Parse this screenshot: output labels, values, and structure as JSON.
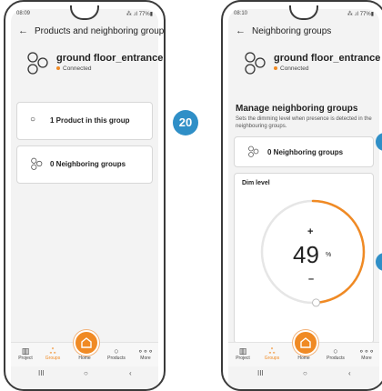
{
  "colors": {
    "accent": "#f08a24",
    "badge": "#2f8fc7"
  },
  "screen1": {
    "status_time": "08:09",
    "status_right": "⁂ .ıl 77%▮",
    "header_title": "Products and neighboring groups",
    "group_name": "ground floor_entrance",
    "status_text": "Connected",
    "rows": [
      {
        "label": "1 Product in this group",
        "icon": "circle-icon"
      },
      {
        "label": "0 Neighboring groups",
        "icon": "neighbor-groups-icon"
      }
    ]
  },
  "screen2": {
    "status_time": "08:10",
    "status_right": "⁂ .ıl 77%▮",
    "header_title": "Neighboring groups",
    "group_name": "ground floor_entrance",
    "status_text": "Connected",
    "section_title": "Manage neighboring groups",
    "section_desc": "Sets the dimming level when presence is detected in the neighbouring groups.",
    "row_label": "0 Neighboring groups",
    "dim_title": "Dim level",
    "dim_plus": "+",
    "dim_value": "49",
    "dim_unit": "%",
    "dim_minus": "–",
    "dim_fraction": 0.49
  },
  "badge": {
    "number": "20"
  },
  "nav": [
    {
      "label": "Project",
      "icon": "project-icon",
      "glyph": "▥"
    },
    {
      "label": "Groups",
      "icon": "groups-icon",
      "glyph": "ஃ"
    },
    {
      "label": "Home",
      "icon": "home-icon",
      "glyph": ""
    },
    {
      "label": "Products",
      "icon": "products-icon",
      "glyph": "○"
    },
    {
      "label": "More",
      "icon": "more-icon",
      "glyph": "∘∘∘"
    }
  ],
  "syskeys": {
    "recent": "III",
    "home": "○",
    "back": "‹"
  }
}
